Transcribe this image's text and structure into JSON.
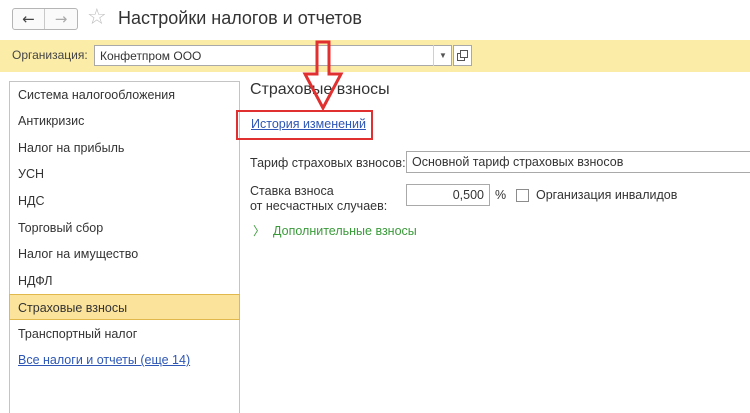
{
  "header": {
    "back_icon": "arrow-left-icon",
    "back_glyph": "←",
    "forward_icon": "arrow-right-icon",
    "forward_glyph": "→",
    "favorite_icon": "star-icon",
    "favorite_glyph": "☆",
    "title": "Настройки налогов и отчетов"
  },
  "org": {
    "label": "Организация:",
    "value": "Конфетпром ООО",
    "dropdown_glyph": "▼",
    "open_icon": "open-form-icon"
  },
  "sidebar": {
    "items": [
      {
        "label": "Система налогообложения"
      },
      {
        "label": "Антикризис"
      },
      {
        "label": "Налог на прибыль"
      },
      {
        "label": "УСН"
      },
      {
        "label": "НДС"
      },
      {
        "label": "Торговый сбор"
      },
      {
        "label": "Налог на имущество"
      },
      {
        "label": "НДФЛ"
      },
      {
        "label": "Страховые взносы",
        "active": true
      },
      {
        "label": "Транспортный налог"
      },
      {
        "label": "Все налоги и отчеты (еще 14)",
        "link": true
      }
    ]
  },
  "content": {
    "title": "Страховые взносы",
    "history_link": "История изменений",
    "tariff_label": "Тариф страховых взносов:",
    "tariff_value": "Основной тариф страховых взносов",
    "rate_label_line1": "Ставка взноса",
    "rate_label_line2": "от несчастных случаев:",
    "rate_value": "0,500",
    "rate_unit": "%",
    "disabled_org_label": "Организация инвалидов",
    "disabled_org_checked": false,
    "extra_icon": "chevron-right-icon",
    "extra_glyph": "〉",
    "extra_label": "Дополнительные взносы"
  },
  "colors": {
    "org_bar_bg": "#fbeca8",
    "active_item_bg": "#fbe39c",
    "link": "#2d56b5",
    "extra_green": "#3a9a3a",
    "annotation_red": "#e03030"
  }
}
